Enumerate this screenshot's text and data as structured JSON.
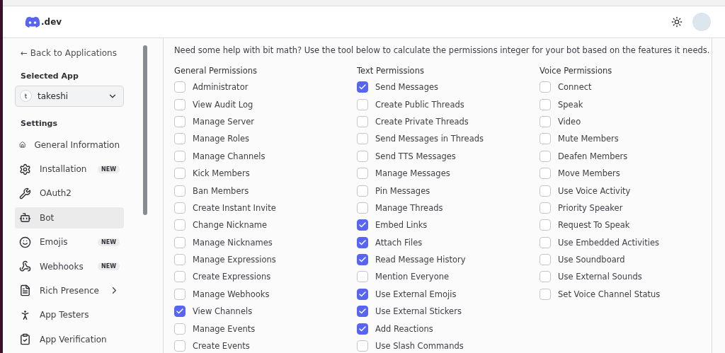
{
  "header": {
    "logo_text": ".dev"
  },
  "sidebar": {
    "back_link": "← Back to Applications",
    "selected_app_label": "Selected App",
    "app_select": {
      "initial": "t",
      "value": "takeshi"
    },
    "settings_label": "Settings",
    "items": [
      {
        "label": "General Information",
        "kind": "link",
        "selected": false
      },
      {
        "label": "Installation",
        "kind": "link",
        "badge": "NEW",
        "selected": false
      },
      {
        "label": "OAuth2",
        "kind": "link",
        "selected": false
      },
      {
        "label": "Bot",
        "kind": "link",
        "selected": true
      },
      {
        "label": "Emojis",
        "kind": "link",
        "badge": "NEW",
        "selected": false
      },
      {
        "label": "Webhooks",
        "kind": "link",
        "badge": "NEW",
        "selected": false
      },
      {
        "label": "Rich Presence",
        "kind": "submenu",
        "selected": false
      },
      {
        "label": "App Testers",
        "kind": "link",
        "selected": false
      },
      {
        "label": "App Verification",
        "kind": "link",
        "selected": false
      }
    ]
  },
  "intro": "Need some help with bit math? Use the tool below to calculate the permissions integer for your bot based on the features it needs.",
  "columns": [
    {
      "title": "General Permissions",
      "items": [
        {
          "label": "Administrator",
          "checked": false
        },
        {
          "label": "View Audit Log",
          "checked": false
        },
        {
          "label": "Manage Server",
          "checked": false
        },
        {
          "label": "Manage Roles",
          "checked": false
        },
        {
          "label": "Manage Channels",
          "checked": false
        },
        {
          "label": "Kick Members",
          "checked": false
        },
        {
          "label": "Ban Members",
          "checked": false
        },
        {
          "label": "Create Instant Invite",
          "checked": false
        },
        {
          "label": "Change Nickname",
          "checked": false
        },
        {
          "label": "Manage Nicknames",
          "checked": false
        },
        {
          "label": "Manage Expressions",
          "checked": false
        },
        {
          "label": "Create Expressions",
          "checked": false
        },
        {
          "label": "Manage Webhooks",
          "checked": false
        },
        {
          "label": "View Channels",
          "checked": true
        },
        {
          "label": "Manage Events",
          "checked": false
        },
        {
          "label": "Create Events",
          "checked": false
        }
      ]
    },
    {
      "title": "Text Permissions",
      "items": [
        {
          "label": "Send Messages",
          "checked": true
        },
        {
          "label": "Create Public Threads",
          "checked": false
        },
        {
          "label": "Create Private Threads",
          "checked": false
        },
        {
          "label": "Send Messages in Threads",
          "checked": false
        },
        {
          "label": "Send TTS Messages",
          "checked": false
        },
        {
          "label": "Manage Messages",
          "checked": false
        },
        {
          "label": "Pin Messages",
          "checked": false
        },
        {
          "label": "Manage Threads",
          "checked": false
        },
        {
          "label": "Embed Links",
          "checked": true
        },
        {
          "label": "Attach Files",
          "checked": true
        },
        {
          "label": "Read Message History",
          "checked": true
        },
        {
          "label": "Mention Everyone",
          "checked": false
        },
        {
          "label": "Use External Emojis",
          "checked": true
        },
        {
          "label": "Use External Stickers",
          "checked": true
        },
        {
          "label": "Add Reactions",
          "checked": true
        },
        {
          "label": "Use Slash Commands",
          "checked": false
        }
      ]
    },
    {
      "title": "Voice Permissions",
      "items": [
        {
          "label": "Connect",
          "checked": false
        },
        {
          "label": "Speak",
          "checked": false
        },
        {
          "label": "Video",
          "checked": false
        },
        {
          "label": "Mute Members",
          "checked": false
        },
        {
          "label": "Deafen Members",
          "checked": false
        },
        {
          "label": "Move Members",
          "checked": false
        },
        {
          "label": "Use Voice Activity",
          "checked": false
        },
        {
          "label": "Priority Speaker",
          "checked": false
        },
        {
          "label": "Request To Speak",
          "checked": false
        },
        {
          "label": "Use Embedded Activities",
          "checked": false
        },
        {
          "label": "Use Soundboard",
          "checked": false
        },
        {
          "label": "Use External Sounds",
          "checked": false
        },
        {
          "label": "Set Voice Channel Status",
          "checked": false
        }
      ]
    }
  ]
}
